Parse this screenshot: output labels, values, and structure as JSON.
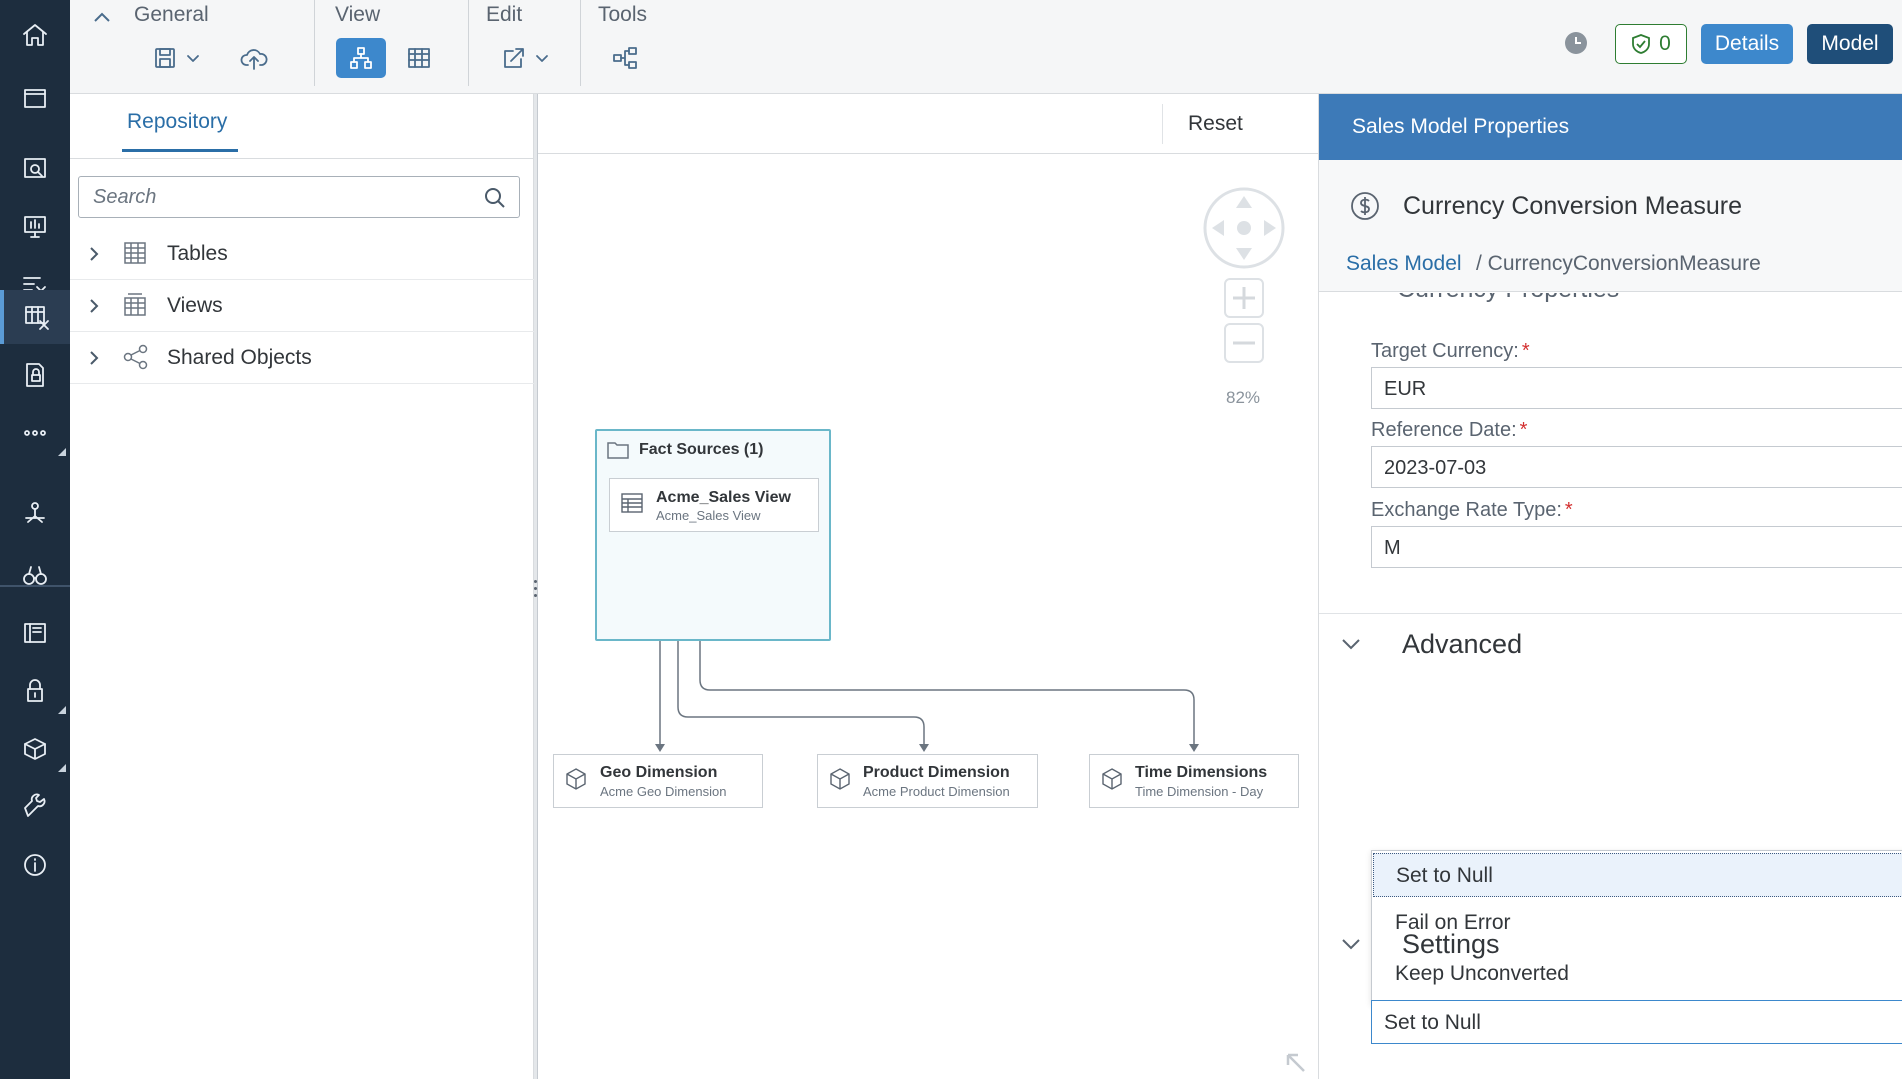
{
  "toolbar": {
    "groups": {
      "general": "General",
      "view": "View",
      "edit": "Edit",
      "tools": "Tools"
    },
    "issues_count": "0",
    "details_label": "Details",
    "model_label": "Model"
  },
  "repository": {
    "tab": "Repository",
    "search_placeholder": "Search",
    "items": [
      {
        "label": "Tables",
        "icon": "table-icon"
      },
      {
        "label": "Views",
        "icon": "view-icon"
      },
      {
        "label": "Shared Objects",
        "icon": "share-icon"
      }
    ]
  },
  "canvas": {
    "reset_label": "Reset",
    "zoom_level": "82%",
    "fact_sources": {
      "title": "Fact Sources (1)",
      "view_name": "Acme_Sales View",
      "view_sub": "Acme_Sales View"
    },
    "dimensions": [
      {
        "title": "Geo Dimension",
        "sub": "Acme Geo Dimension"
      },
      {
        "title": "Product Dimension",
        "sub": "Acme Product Dimension"
      },
      {
        "title": "Time Dimensions",
        "sub": "Time Dimension - Day"
      }
    ]
  },
  "properties": {
    "header": "Sales Model Properties",
    "object_title": "Currency Conversion Measure",
    "breadcrumb_link": "Sales Model",
    "breadcrumb_rest": "/ CurrencyConversionMeasure",
    "hidden_section": "Currency Properties",
    "fields": {
      "target_currency_label": "Target Currency:",
      "target_currency_value": "EUR",
      "reference_date_label": "Reference Date:",
      "reference_date_value": "2023-07-03",
      "exchange_rate_label": "Exchange Rate Type:",
      "exchange_rate_value": "M",
      "required_marker": "*"
    },
    "advanced": {
      "title": "Advanced",
      "options": [
        "Set to Null",
        "Fail on Error",
        "Keep Unconverted"
      ],
      "selected": "Set to Null"
    },
    "settings_title": "Settings"
  },
  "colors": {
    "rail_bg": "#1d2d3e",
    "accent": "#3d88cc",
    "header_blue": "#3d7ab8",
    "success": "#2e7d32",
    "required": "#d32f2f"
  }
}
